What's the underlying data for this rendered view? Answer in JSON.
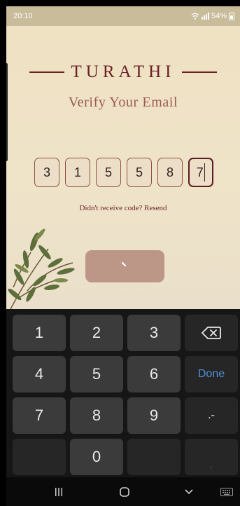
{
  "status": {
    "time": "20:10",
    "battery": "54%"
  },
  "app": {
    "brand": "TURATHI",
    "title": "Verify Your Email",
    "otp_digits": [
      "3",
      "1",
      "5",
      "5",
      "8",
      "7"
    ],
    "resend_text": "Didn't receive code? Resend"
  },
  "keyboard": {
    "row1": [
      "1",
      "2",
      "3"
    ],
    "row2": [
      "4",
      "5",
      "6"
    ],
    "done_label": "Done",
    "row3": [
      "7",
      "8",
      "9"
    ],
    "punct_label": ".-",
    "zero": "0",
    "comma": ","
  },
  "colors": {
    "brand": "#6b1f27",
    "title": "#9b5a52",
    "button": "#bc9788",
    "done": "#4f8fd6"
  },
  "icons": [
    "wifi-icon",
    "signal-icon",
    "battery-icon",
    "backspace-icon",
    "spinner-icon",
    "nav-recents-icon",
    "nav-home-icon",
    "nav-back-icon",
    "keyboard-switch-icon"
  ]
}
